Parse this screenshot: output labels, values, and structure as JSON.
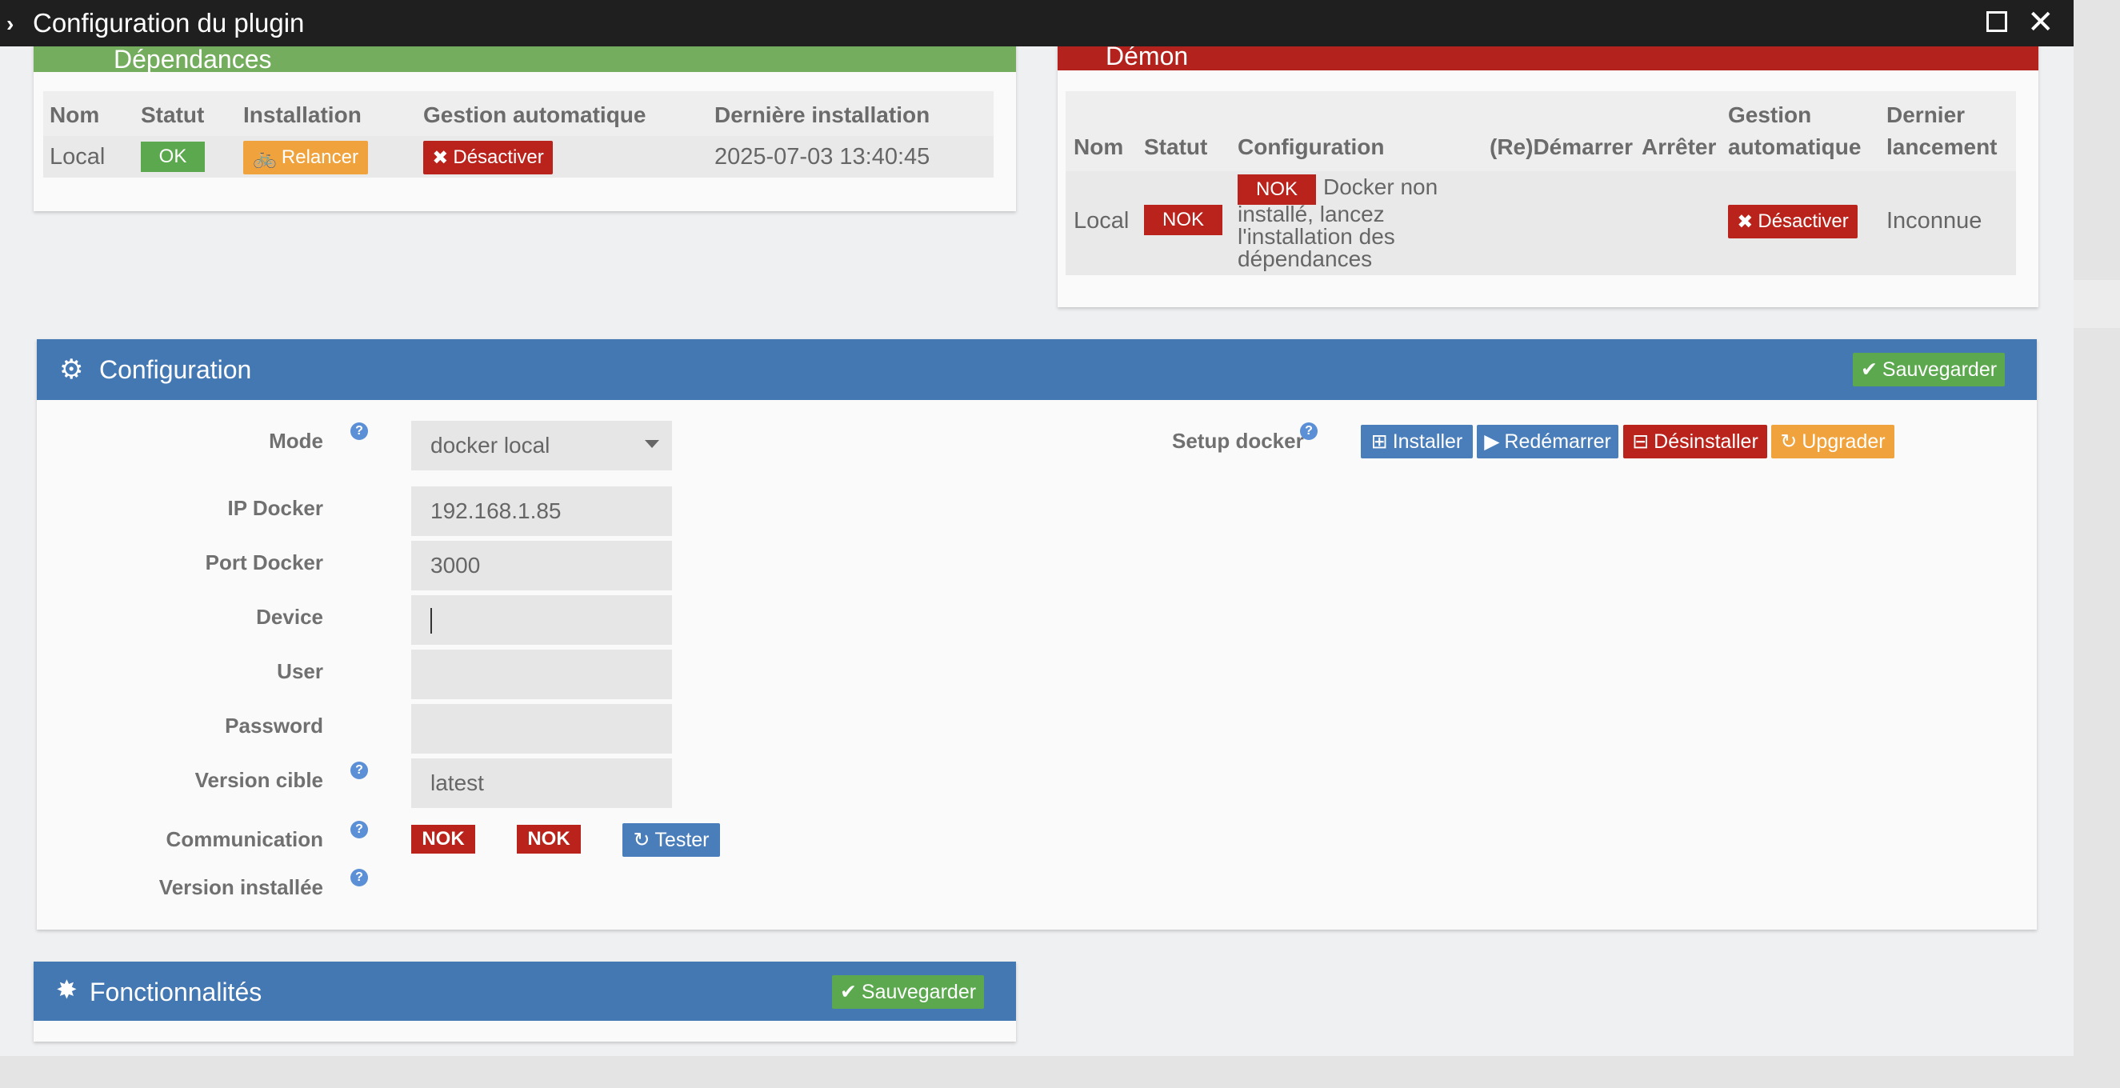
{
  "window": {
    "title": "Configuration du plugin"
  },
  "dependances": {
    "title": "Dépendances",
    "headers": [
      "Nom",
      "Statut",
      "Installation",
      "Gestion automatique",
      "Dernière installation"
    ],
    "row": {
      "nom": "Local",
      "statut": "OK",
      "installation": "Relancer",
      "gestion": "Désactiver",
      "derniere": "2025-07-03 13:40:45"
    }
  },
  "demon": {
    "title": "Démon",
    "headers": {
      "nom": "Nom",
      "statut": "Statut",
      "configuration": "Configuration",
      "demarrer": "(Re)Démarrer",
      "arreter": "Arrêter",
      "gestion_1": "Gestion",
      "gestion_2": "automatique",
      "dernier_1": "Dernier",
      "dernier_2": "lancement"
    },
    "row": {
      "nom": "Local",
      "statut": "NOK",
      "config_badge": "NOK",
      "config_text_1": "Docker non",
      "config_text_2": "installé, lancez",
      "config_text_3": "l'installation des",
      "config_text_4": "dépendances",
      "gestion": "Désactiver",
      "dernier": "Inconnue"
    }
  },
  "configuration": {
    "title": "Configuration",
    "save_label": "Sauvegarder",
    "fields": {
      "mode_label": "Mode",
      "mode_value": "docker local",
      "ip_label": "IP Docker",
      "ip_value": "192.168.1.85",
      "port_label": "Port Docker",
      "port_value": "3000",
      "device_label": "Device",
      "device_value": "",
      "user_label": "User",
      "user_value": "",
      "password_label": "Password",
      "password_value": "",
      "version_cible_label": "Version cible",
      "version_cible_value": "latest",
      "communication_label": "Communication",
      "comm_badge_1": "NOK",
      "comm_badge_2": "NOK",
      "tester_label": "Tester",
      "version_installee_label": "Version installée"
    },
    "setup": {
      "label": "Setup docker",
      "installer": "Installer",
      "redemarrer": "Redémarrer",
      "desinstaller": "Désinstaller",
      "upgrader": "Upgrader"
    }
  },
  "fonctionnalites": {
    "title": "Fonctionnalités",
    "save_label": "Sauvegarder"
  },
  "colors": {
    "green": "#75ad5f",
    "red": "#b3221c",
    "blue": "#4478b3",
    "orange": "#f0a33d",
    "dark": "#1f1f1f"
  }
}
